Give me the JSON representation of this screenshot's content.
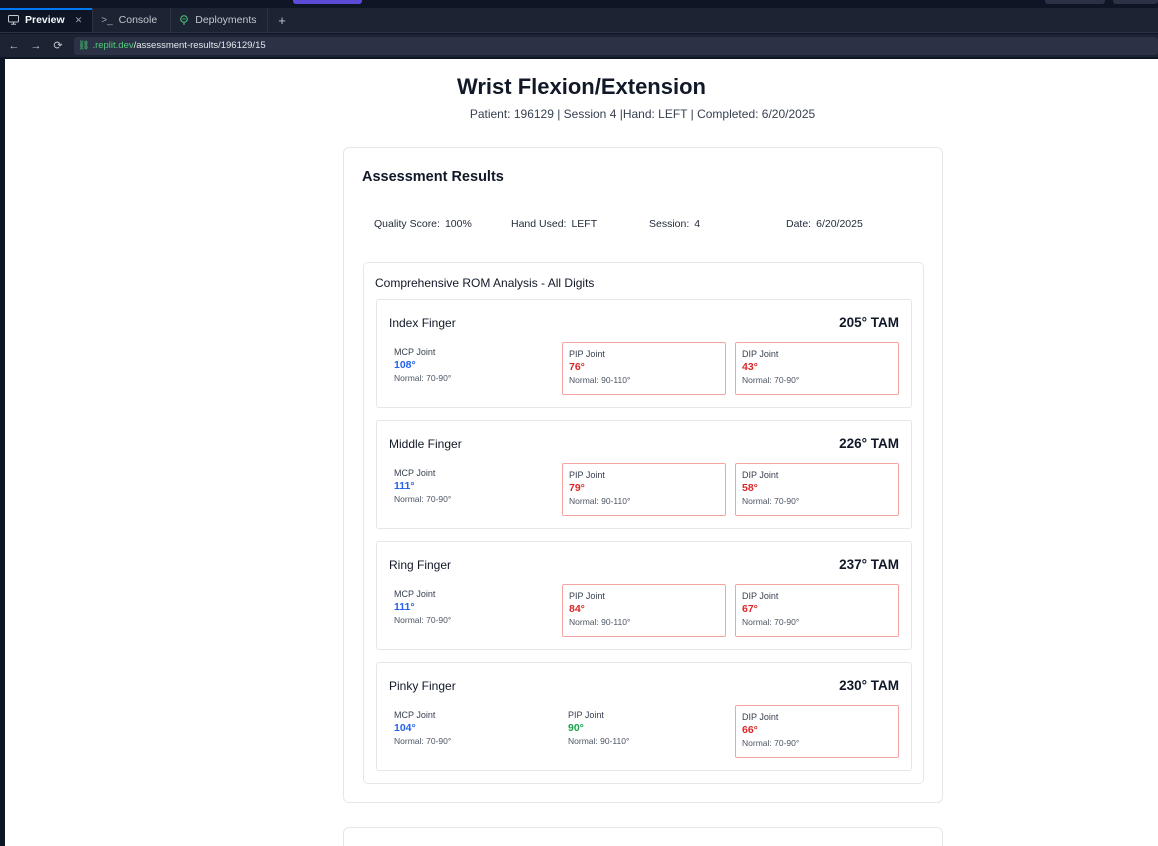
{
  "tabs": [
    {
      "label": "Preview",
      "icon": "monitor-icon",
      "active": true
    },
    {
      "label": "Console",
      "icon": "terminal-icon",
      "active": false
    },
    {
      "label": "Deployments",
      "icon": "deploy-icon",
      "active": false
    }
  ],
  "address": {
    "host": ".replit.dev",
    "path": "/assessment-results/196129/15"
  },
  "page": {
    "title": "Wrist Flexion/Extension",
    "subtitle": "Patient: 196129 | Session 4 |Hand: LEFT | Completed: 6/20/2025"
  },
  "results": {
    "title": "Assessment Results",
    "meta": [
      {
        "label": "Quality Score:",
        "value": "100%"
      },
      {
        "label": "Hand Used:",
        "value": "LEFT"
      },
      {
        "label": "Session:",
        "value": "4"
      },
      {
        "label": "Date:",
        "value": "6/20/2025"
      }
    ],
    "rom_title": "Comprehensive ROM Analysis - All Digits",
    "fingers": [
      {
        "name": "Index Finger",
        "tam": "205° TAM",
        "mcp": {
          "label": "MCP Joint",
          "value": "108°",
          "normal": "Normal: 70-90°"
        },
        "pip": {
          "label": "PIP Joint",
          "value": "76°",
          "normal": "Normal: 90-110°"
        },
        "dip": {
          "label": "DIP Joint",
          "value": "43°",
          "normal": "Normal: 70-90°"
        }
      },
      {
        "name": "Middle Finger",
        "tam": "226° TAM",
        "mcp": {
          "label": "MCP Joint",
          "value": "111°",
          "normal": "Normal: 70-90°"
        },
        "pip": {
          "label": "PIP Joint",
          "value": "79°",
          "normal": "Normal: 90-110°"
        },
        "dip": {
          "label": "DIP Joint",
          "value": "58°",
          "normal": "Normal: 70-90°"
        }
      },
      {
        "name": "Ring Finger",
        "tam": "237° TAM",
        "mcp": {
          "label": "MCP Joint",
          "value": "111°",
          "normal": "Normal: 70-90°"
        },
        "pip": {
          "label": "PIP Joint",
          "value": "84°",
          "normal": "Normal: 90-110°"
        },
        "dip": {
          "label": "DIP Joint",
          "value": "67°",
          "normal": "Normal: 70-90°"
        }
      },
      {
        "name": "Pinky Finger",
        "tam": "230° TAM",
        "mcp": {
          "label": "MCP Joint",
          "value": "104°",
          "normal": "Normal: 70-90°"
        },
        "pip": {
          "label": "PIP Joint",
          "value": "90°",
          "normal": "Normal: 90-110°"
        },
        "dip": {
          "label": "DIP Joint",
          "value": "66°",
          "normal": "Normal: 70-90°"
        }
      }
    ]
  },
  "colors": {
    "above_normal": "#2563eb",
    "below_normal": "#dc2626",
    "within_normal": "#16a34a",
    "flag_border": "#f4a3a3"
  }
}
